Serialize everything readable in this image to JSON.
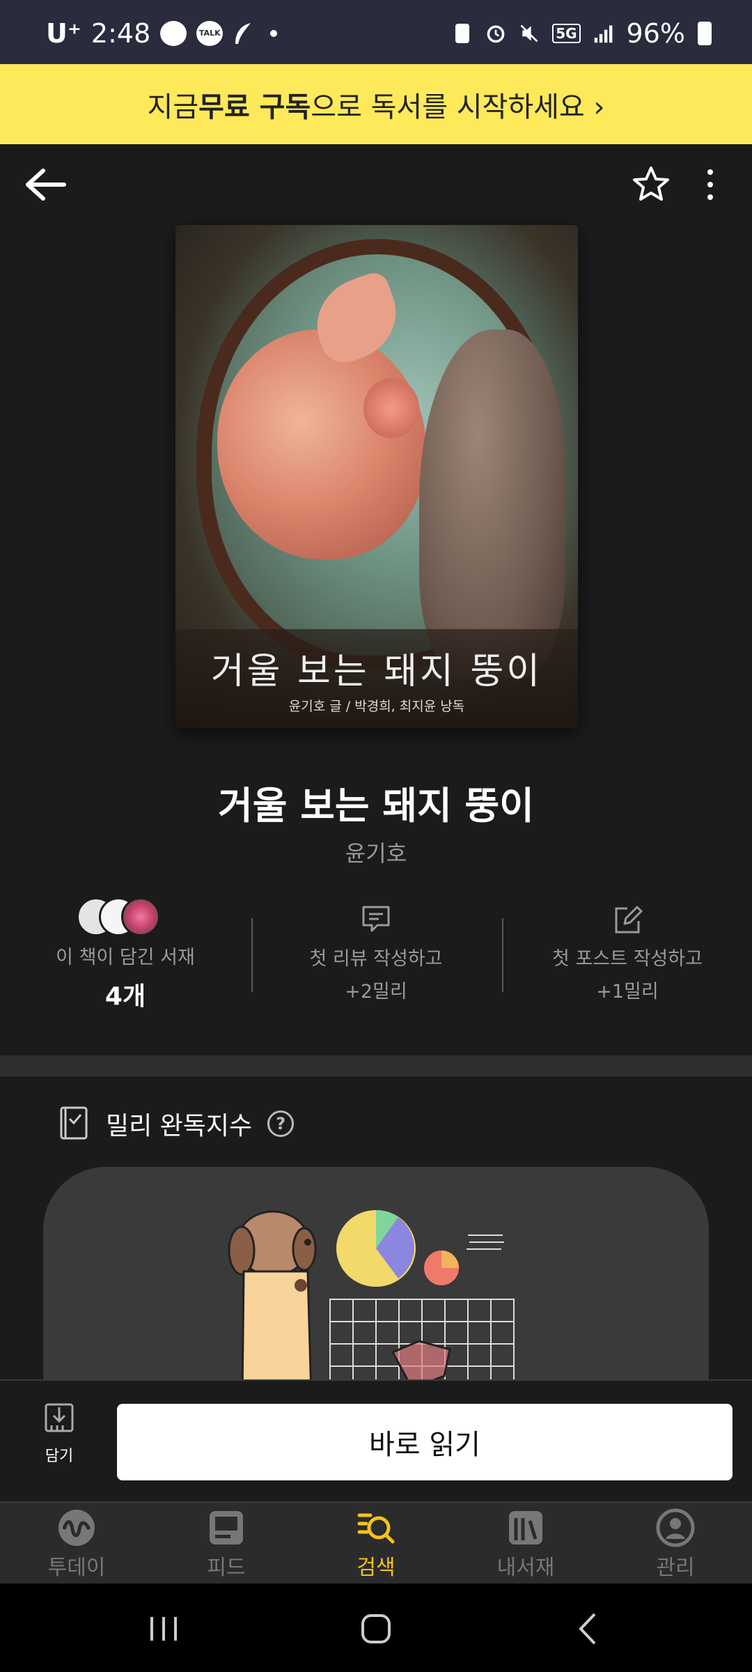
{
  "status_bar": {
    "carrier": "U⁺",
    "time": "2:48",
    "notif_talk": "TALK",
    "battery": "96%",
    "network": "5G"
  },
  "promo": {
    "prefix": "지금 ",
    "bold": "무료 구독",
    "suffix": "으로 독서를 시작하세요 ›"
  },
  "cover": {
    "title": "거울 보는 돼지 뚱이",
    "credits": "윤기호 글 / 박경희, 최지윤 낭독"
  },
  "book": {
    "title": "거울 보는 돼지 뚱이",
    "author": "윤기호"
  },
  "stats": {
    "shelves_label": "이 책이 담긴 서재",
    "shelves_count": "4개",
    "review_line1": "첫 리뷰 작성하고",
    "review_line2": "+2밀리",
    "post_line1": "첫 포스트 작성하고",
    "post_line2": "+1밀리"
  },
  "section": {
    "title": "밀리 완독지수",
    "help": "?"
  },
  "actions": {
    "save_label": "담기",
    "read_label": "바로 읽기"
  },
  "tabs": [
    {
      "label": "투데이",
      "icon": "wave-icon"
    },
    {
      "label": "피드",
      "icon": "feed-icon"
    },
    {
      "label": "검색",
      "icon": "search-icon"
    },
    {
      "label": "내서재",
      "icon": "bookshelf-icon"
    },
    {
      "label": "관리",
      "icon": "profile-icon"
    }
  ],
  "colors": {
    "accent": "#f6c21d",
    "promo_bg": "#fde95a",
    "background": "#1b1b1b"
  }
}
